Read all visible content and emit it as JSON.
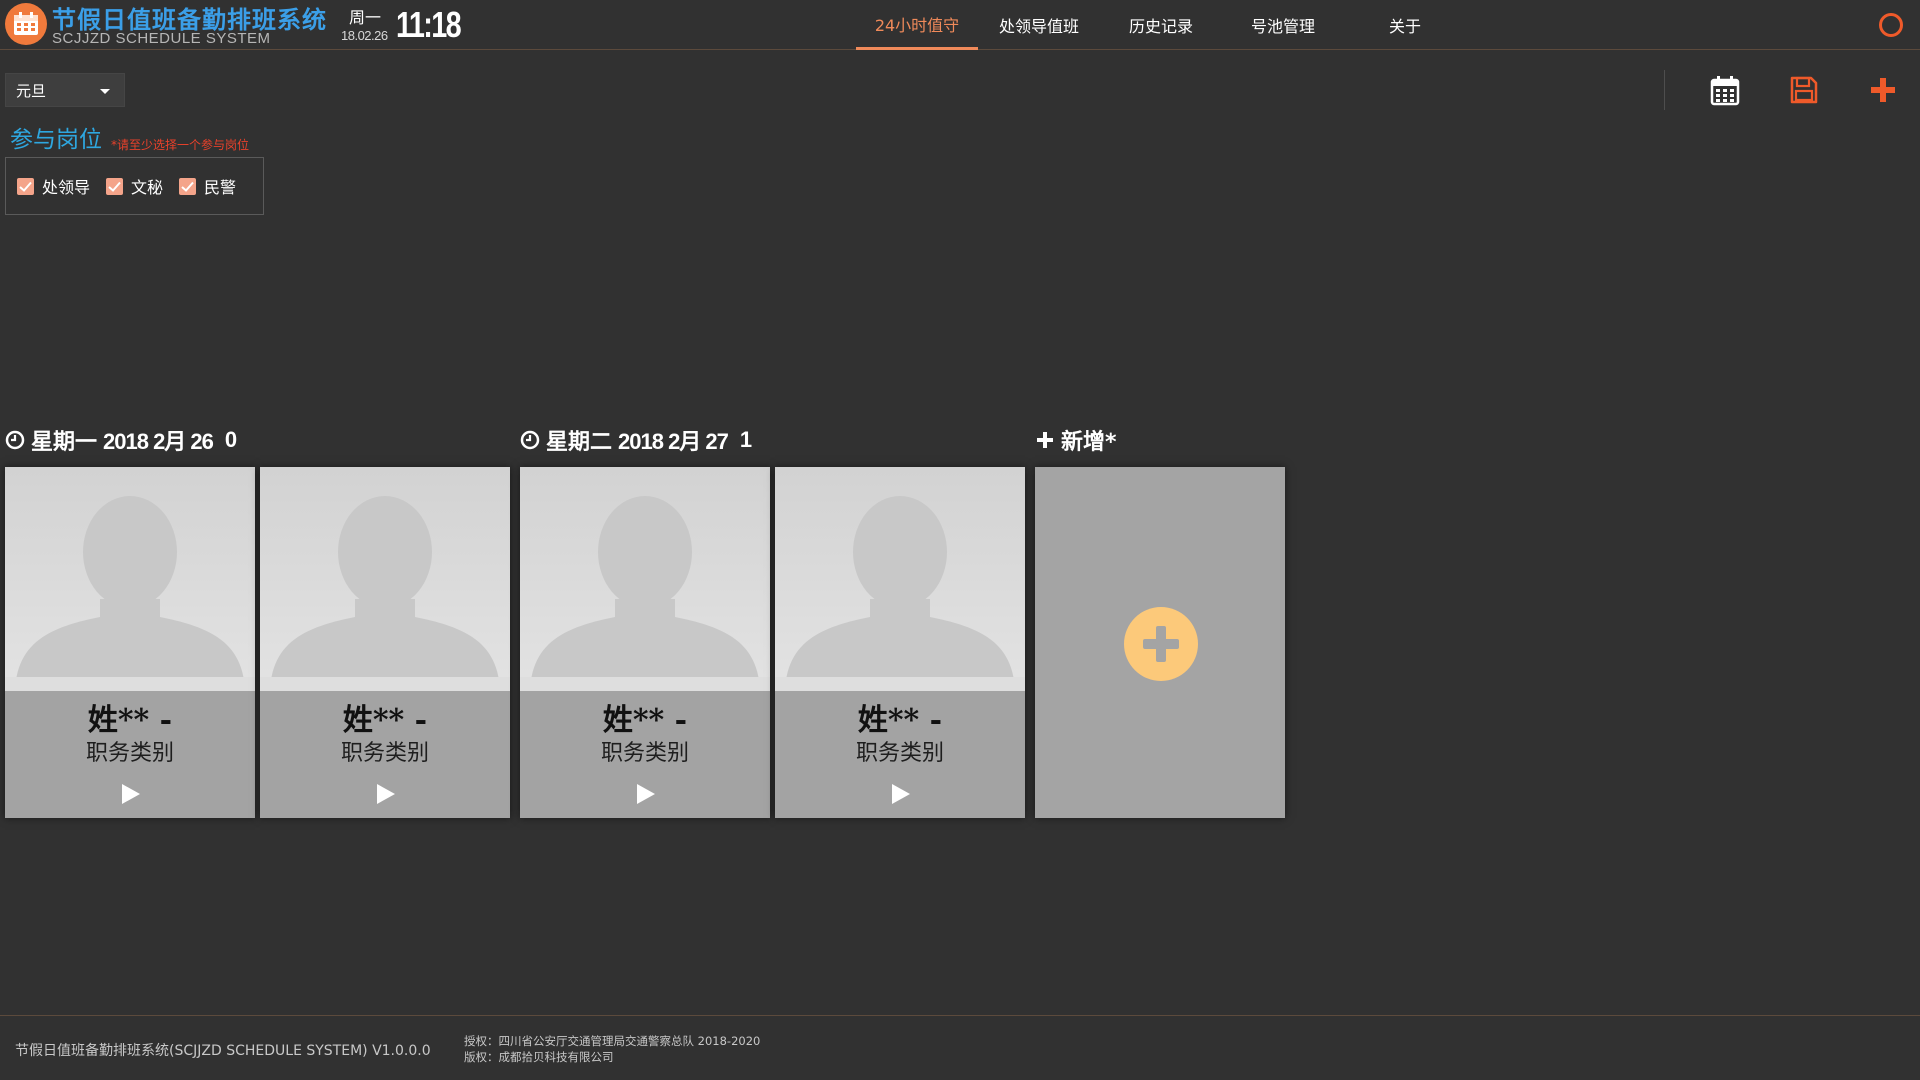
{
  "header": {
    "app_title": "节假日值班备勤排班系统",
    "app_subtitle": "SCJJZD SCHEDULE SYSTEM",
    "weekday": "周一",
    "date_short": "18.02.26",
    "time": "11:18",
    "nav": [
      {
        "label": "24小时值守",
        "active": true
      },
      {
        "label": "处领导值班",
        "active": false
      },
      {
        "label": "历史记录",
        "active": false
      },
      {
        "label": "号池管理",
        "active": false
      },
      {
        "label": "关于",
        "active": false
      }
    ],
    "accent_color": "#f08a5a",
    "power_icon": "power-icon"
  },
  "toolbar": {
    "holiday_selected": "元旦",
    "tools": [
      "calendar-icon",
      "save-icon",
      "add-icon"
    ]
  },
  "positions": {
    "title": "参与岗位",
    "hint": "*请至少选择一个参与岗位",
    "items": [
      {
        "label": "处领导",
        "checked": true
      },
      {
        "label": "文秘",
        "checked": true
      },
      {
        "label": "民警",
        "checked": true
      }
    ]
  },
  "days": [
    {
      "weekday": "星期一",
      "date": "2018 2月 26",
      "index": "0",
      "cards": [
        {
          "name": "姓** -",
          "role": "职务类别"
        },
        {
          "name": "姓** -",
          "role": "职务类别"
        }
      ]
    },
    {
      "weekday": "星期二",
      "date": "2018 2月 27",
      "index": "1",
      "cards": [
        {
          "name": "姓** -",
          "role": "职务类别"
        },
        {
          "name": "姓** -",
          "role": "职务类别"
        }
      ]
    }
  ],
  "add_group": {
    "label": "新增*"
  },
  "footer": {
    "main": "节假日值班备勤排班系统(SCJJZD SCHEDULE SYSTEM) V1.0.0.0",
    "license": "授权：四川省公安厅交通管理局交通警察总队 2018-2020",
    "copyright": "版权：成都拾贝科技有限公司"
  }
}
